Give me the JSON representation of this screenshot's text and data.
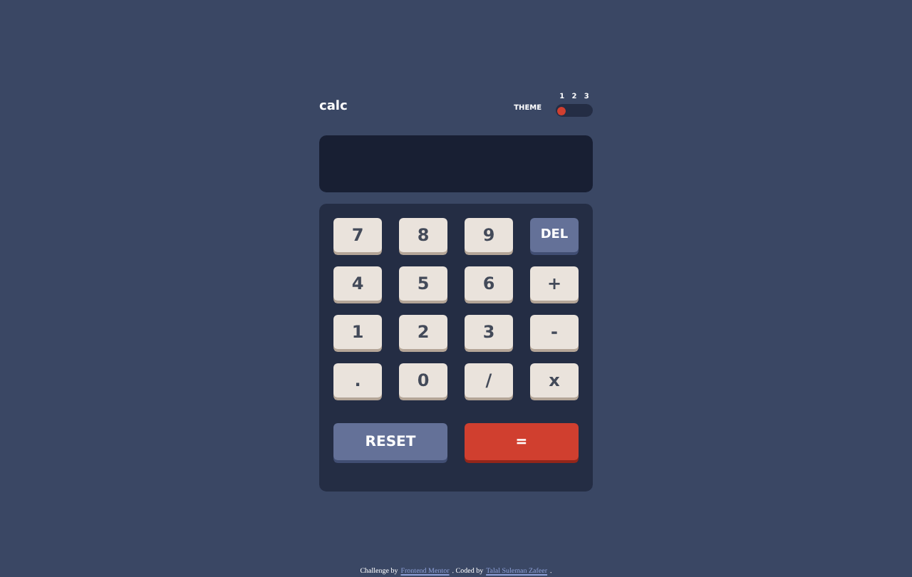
{
  "header": {
    "logo": "calc",
    "theme_label": "THEME",
    "themes": [
      {
        "label": "1",
        "selected": true
      },
      {
        "label": "2",
        "selected": false
      },
      {
        "label": "3",
        "selected": false
      }
    ]
  },
  "keys": [
    {
      "label": "7",
      "kind": "digit"
    },
    {
      "label": "8",
      "kind": "digit"
    },
    {
      "label": "9",
      "kind": "digit"
    },
    {
      "label": "DEL",
      "kind": "del"
    },
    {
      "label": "4",
      "kind": "digit"
    },
    {
      "label": "5",
      "kind": "digit"
    },
    {
      "label": "6",
      "kind": "digit"
    },
    {
      "label": "+",
      "kind": "digit"
    },
    {
      "label": "1",
      "kind": "digit"
    },
    {
      "label": "2",
      "kind": "digit"
    },
    {
      "label": "3",
      "kind": "digit"
    },
    {
      "label": "-",
      "kind": "digit"
    },
    {
      "label": ".",
      "kind": "digit"
    },
    {
      "label": "0",
      "kind": "digit"
    },
    {
      "label": "/",
      "kind": "digit"
    },
    {
      "label": "x",
      "kind": "digit"
    },
    {
      "label": "RESET",
      "kind": "reset"
    },
    {
      "label": "=",
      "kind": "equals"
    }
  ],
  "footer": {
    "text_1": "Challenge by",
    "link_1": "Frontend Mentor",
    "text_2": ". Coded by",
    "link_2": "Talal Suleman Zafeer",
    "text_3": "."
  }
}
